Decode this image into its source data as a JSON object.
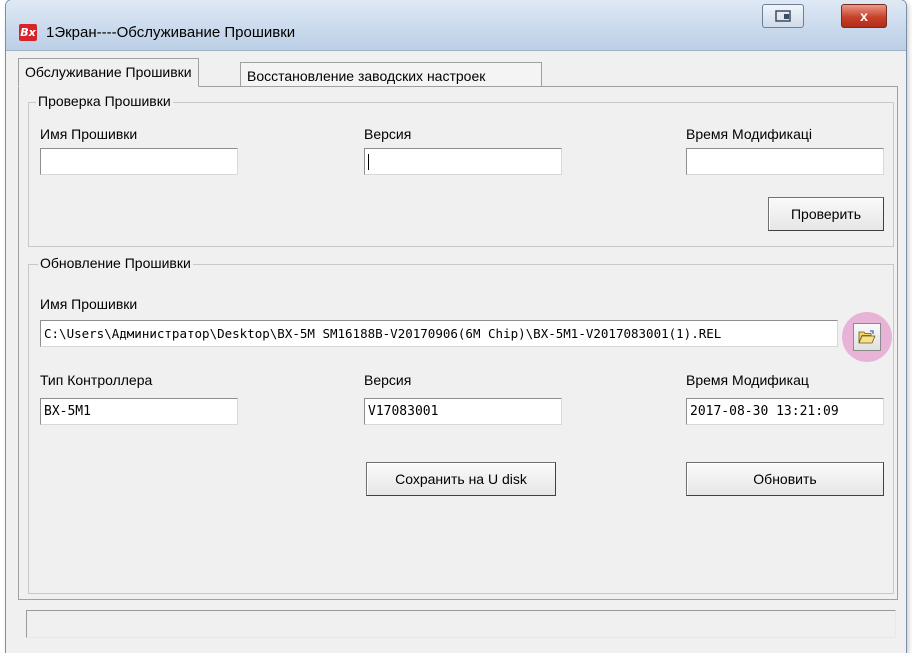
{
  "window": {
    "title": "1Экран----Обслуживание Прошивки",
    "app_icon_text": "Bx",
    "close_label": "x"
  },
  "tabs": [
    {
      "label": "Обслуживание Прошивки",
      "active": true
    },
    {
      "label": "Восстановление заводских настроек",
      "active": false
    }
  ],
  "check_group": {
    "title": "Проверка Прошивки",
    "firmware_name_label": "Имя Прошивки",
    "firmware_name_value": "",
    "version_label": "Версия",
    "version_value": "",
    "mod_time_label": "Время Модификаці",
    "mod_time_value": "",
    "check_button": "Проверить"
  },
  "update_group": {
    "title": "Обновление Прошивки",
    "firmware_name_label": "Имя Прошивки",
    "firmware_path": "C:\\Users\\Администратор\\Desktop\\BX-5M SM16188B-V20170906(6M Chip)\\BX-5M1-V2017083001(1).REL",
    "controller_type_label": "Тип Контроллера",
    "controller_type_value": "BX-5M1",
    "version_label": "Версия",
    "version_value": "V17083001",
    "mod_time_label": "Время Модификац",
    "mod_time_value": "2017-08-30 13:21:09",
    "save_button": "Сохранить на  U disk",
    "update_button": "Обновить"
  },
  "icons": {
    "browse": "folder-open-icon",
    "restore": "restore-window-icon",
    "close": "close-icon",
    "app": "app-logo-icon"
  },
  "colors": {
    "close_button": "#c7412b",
    "browse_highlight": "#e7b3d7",
    "app_icon": "#d8232a"
  }
}
